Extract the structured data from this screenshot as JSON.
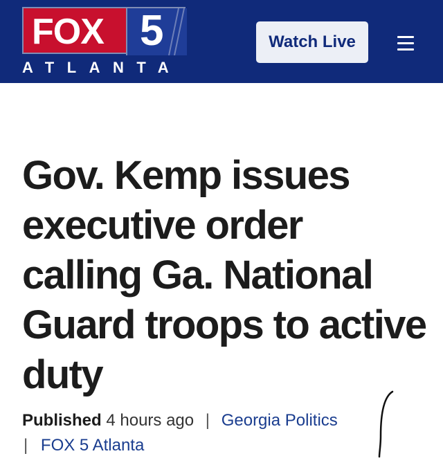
{
  "header": {
    "logo": {
      "brand": "FOX",
      "channel": "5",
      "city": "ATLANTA"
    },
    "watch_live_label": "Watch Live",
    "menu_icon": "hamburger-menu-icon"
  },
  "article": {
    "headline": "Gov. Kemp issues executive order calling Ga. National Guard troops to active duty",
    "meta": {
      "published_label": "Published",
      "published_time": "4 hours ago",
      "separator": "|",
      "category": "Georgia Politics",
      "source": "FOX 5 Atlanta"
    }
  },
  "colors": {
    "header_bg": "#102a7a",
    "logo_red": "#c8102e",
    "link": "#1a3d8f",
    "headline": "#1c1c1c"
  }
}
